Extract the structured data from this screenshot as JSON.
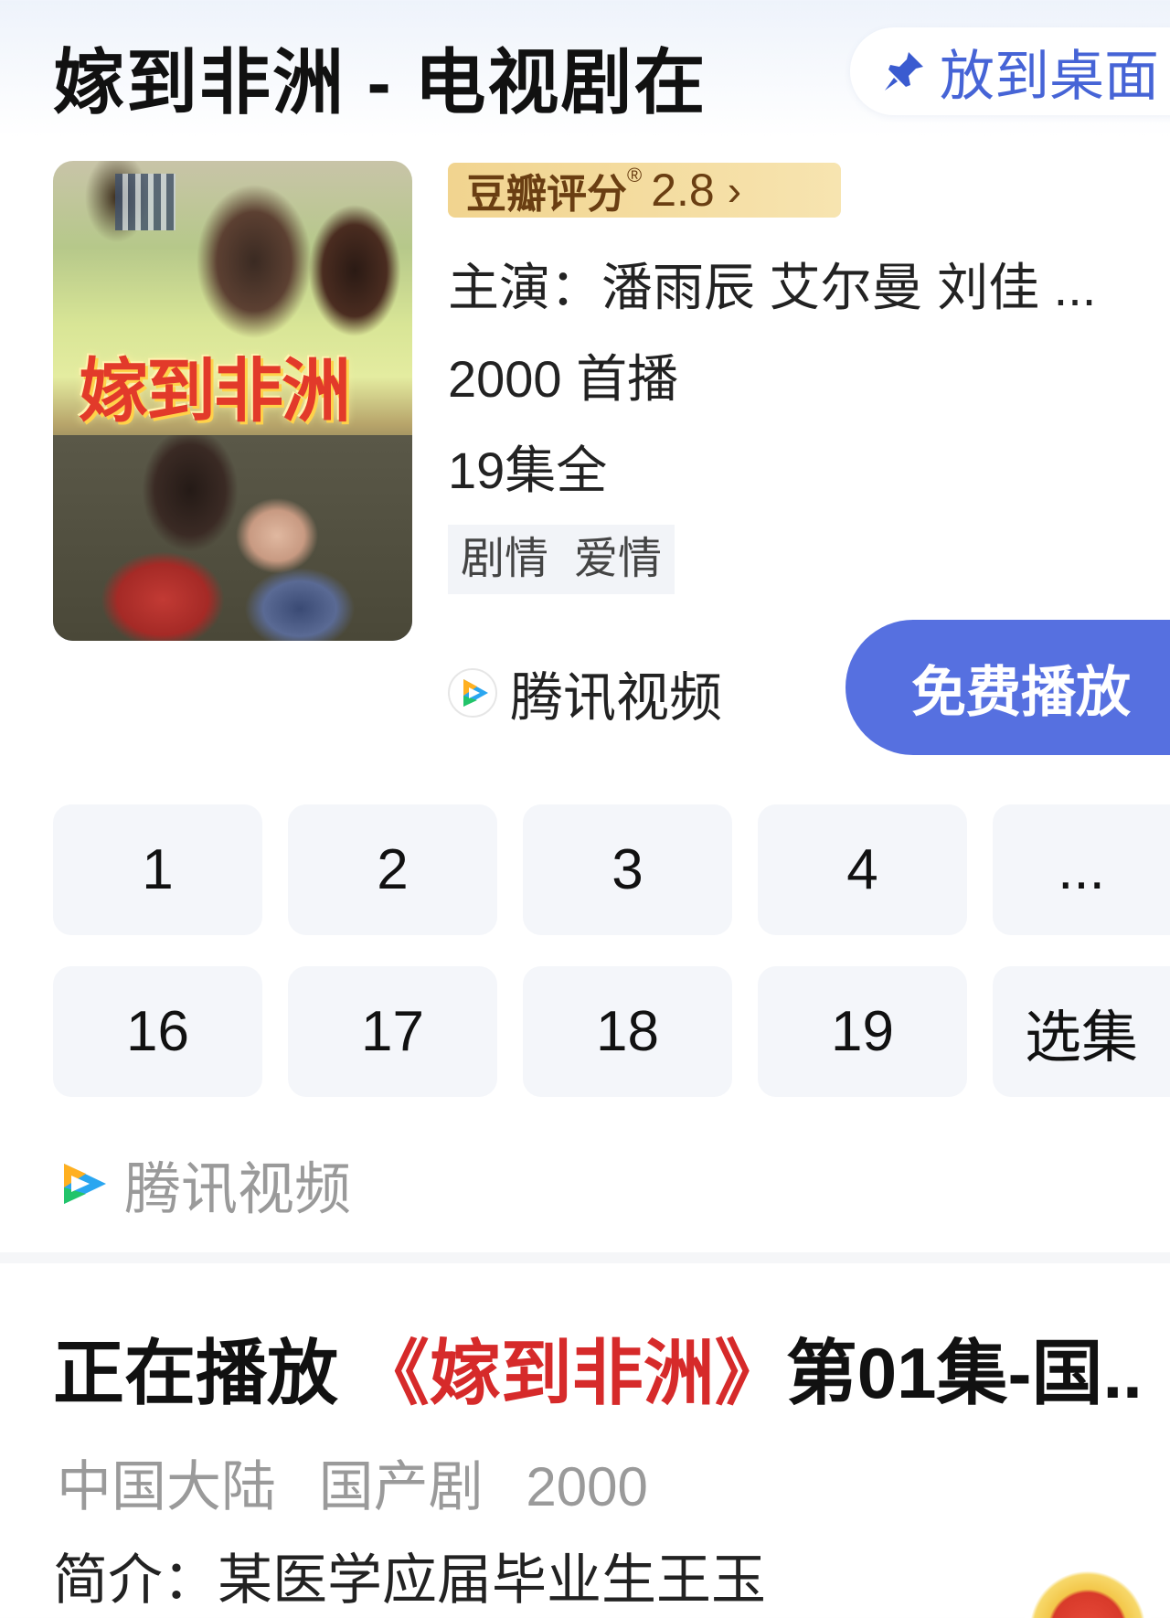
{
  "header": {
    "title": "嫁到非洲 - 电视剧在",
    "desktop_button_label": "放到桌面"
  },
  "poster": {
    "title_text": "嫁到非洲"
  },
  "rating": {
    "label": "豆瓣评分",
    "registered": "®",
    "value": "2.8",
    "chevron": "›"
  },
  "details": {
    "cast": "主演：潘雨辰 艾尔曼 刘佳 ...",
    "premiere": "2000 首播",
    "episodes_total": "19集全",
    "tags": [
      "剧情",
      "爱情"
    ]
  },
  "provider": {
    "name": "腾讯视频",
    "icon": "tencent-video-icon"
  },
  "play_button": {
    "label": "免费播放",
    "color": "#5670e0"
  },
  "episodes": {
    "row1": [
      "1",
      "2",
      "3",
      "4",
      "..."
    ],
    "row2": [
      "16",
      "17",
      "18",
      "19",
      "选集"
    ]
  },
  "source": {
    "name": "腾讯视频"
  },
  "now_playing": {
    "prefix": "正在播放",
    "title": "《嫁到非洲》",
    "suffix": "第01集-国..",
    "title_color": "#d62a2a"
  },
  "meta": {
    "region": "中国大陆",
    "category": "国产剧",
    "year": "2000"
  },
  "synopsis": {
    "text": "简介：某医学应届毕业生王玉"
  }
}
